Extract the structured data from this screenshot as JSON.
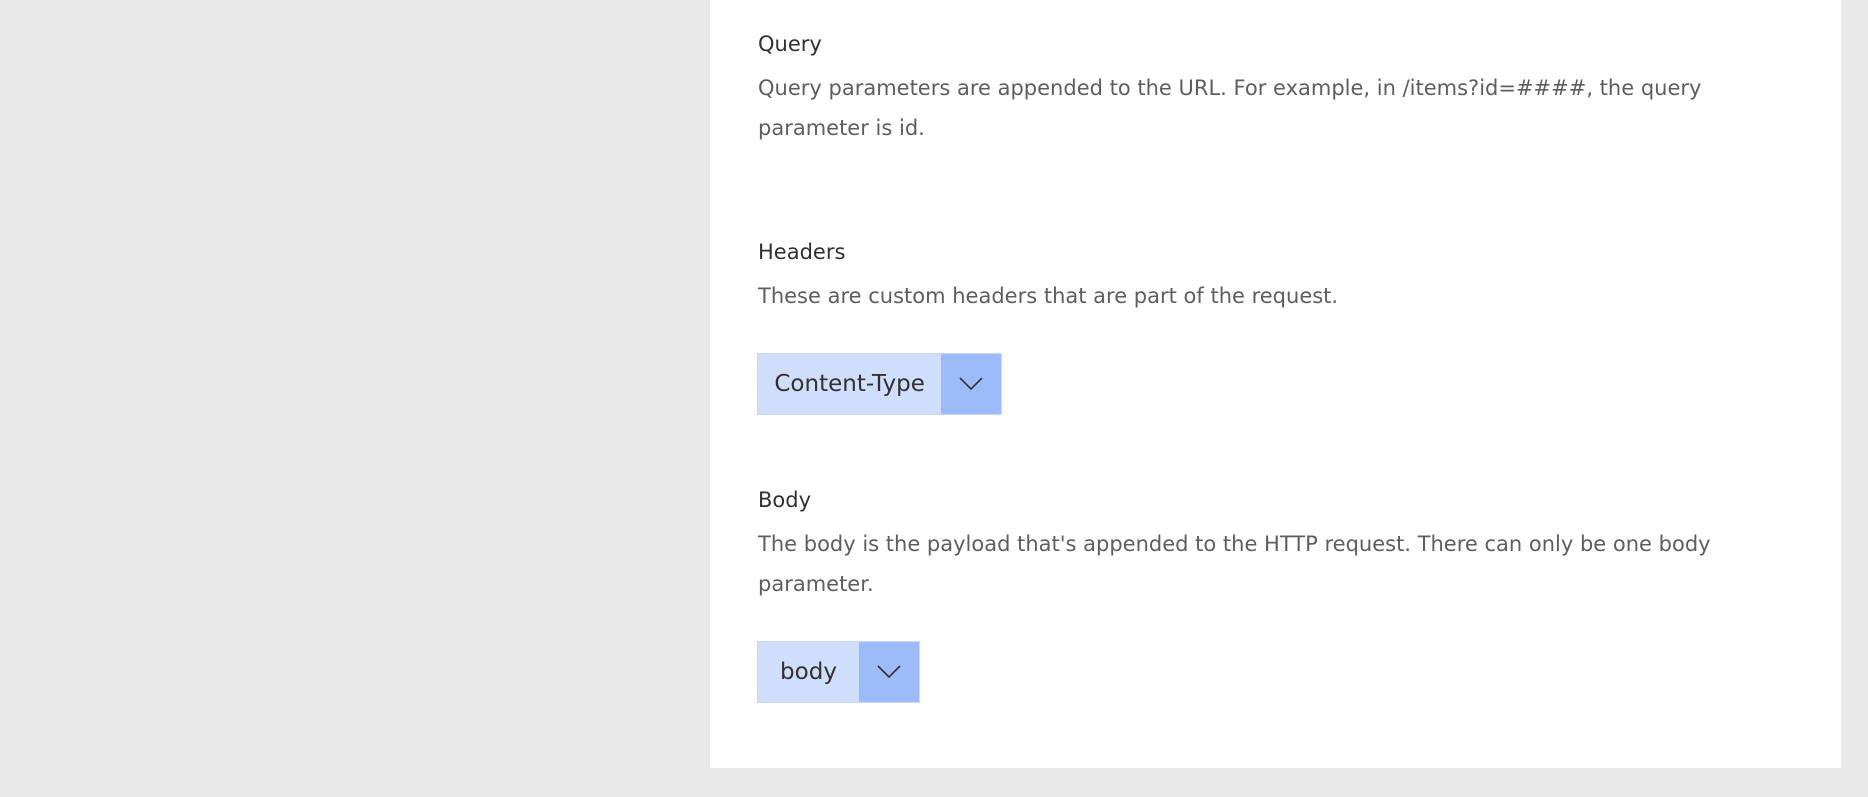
{
  "sections": [
    {
      "title": "Query",
      "description": "Query parameters are appended to the URL. For example, in /items?id=####, the query parameter is id."
    },
    {
      "title": "Headers",
      "description": "These are custom headers that are part of the request.",
      "chip_label": "Content-Type",
      "chip_icon": "chevron-down-icon"
    },
    {
      "title": "Body",
      "description": "The body is the payload that's appended to the HTTP request. There can only be one body parameter.",
      "chip_label": "body",
      "chip_icon": "chevron-down-icon"
    }
  ],
  "colors": {
    "background": "#e9e9e9",
    "panel": "#ffffff",
    "chip_label_bg": "#cfdefb",
    "chip_toggle_bg": "#9ebbf9",
    "title_text": "#323130",
    "desc_text": "#605e5c"
  }
}
